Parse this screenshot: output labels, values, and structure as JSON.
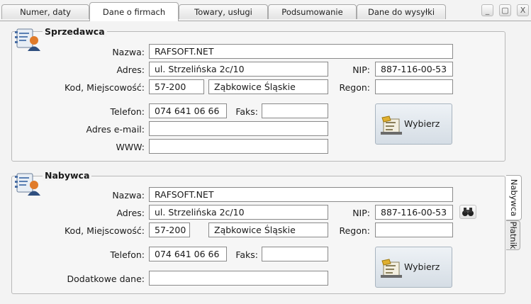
{
  "tabs": [
    {
      "label": "Numer, daty"
    },
    {
      "label": "Dane o firmach"
    },
    {
      "label": "Towary, usługi"
    },
    {
      "label": "Podsumowanie"
    },
    {
      "label": "Dane do wysyłki"
    }
  ],
  "window_buttons": {
    "minimize": "_",
    "restore": "▢",
    "close": "X"
  },
  "seller": {
    "title": "Sprzedawca",
    "name_label": "Nazwa:",
    "name": "RAFSOFT.NET",
    "address_label": "Adres:",
    "address": "ul. Strzelińska 2c/10",
    "nip_label": "NIP:",
    "nip": "887-116-00-53",
    "city_label": "Kod, Miejscowość:",
    "postal_code": "57-200",
    "city": "Ząbkowice Śląskie",
    "regon_label": "Regon:",
    "regon": "",
    "phone_label": "Telefon:",
    "phone": "074 641 06 66",
    "fax_label": "Faks:",
    "fax": "",
    "email_label": "Adres e-mail:",
    "email": "",
    "www_label": "WWW:",
    "www": "",
    "select_button": "Wybierz"
  },
  "buyer": {
    "title": "Nabywca",
    "name_label": "Nazwa:",
    "name": "RAFSOFT.NET",
    "address_label": "Adres:",
    "address": "ul. Strzelińska 2c/10",
    "nip_label": "NIP:",
    "nip": "887-116-00-53",
    "city_label": "Kod, Miejscowość:",
    "postal_code": "57-200",
    "city": "Ząbkowice Śląskie",
    "regon_label": "Regon:",
    "regon": "",
    "phone_label": "Telefon:",
    "phone": "074 641 06 66",
    "fax_label": "Faks:",
    "fax": "",
    "extra_label": "Dodatkowe dane:",
    "extra": "",
    "select_button": "Wybierz"
  },
  "side_tabs": [
    {
      "label": "Nabywca"
    },
    {
      "label": "Płatnik"
    }
  ],
  "icons": {
    "seller": "contact-card-icon",
    "buyer": "contact-card-icon",
    "nip_lookup": "binoculars-icon",
    "select": "address-book-icon"
  }
}
